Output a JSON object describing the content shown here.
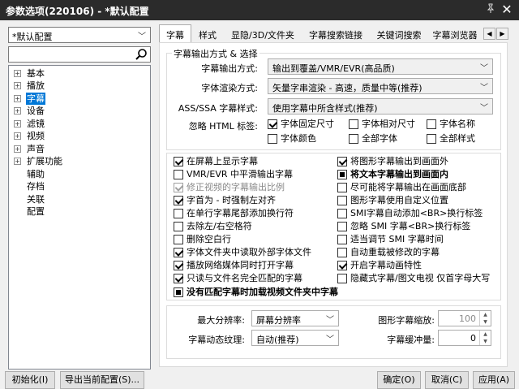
{
  "window": {
    "title": "参数选项(220106) - *默认配置",
    "pin_icon": "pin-icon",
    "close_icon": "close-icon"
  },
  "sidebar": {
    "profile": "*默认配置",
    "search_placeholder": "",
    "tree": [
      {
        "label": "基本",
        "expandable": true,
        "selected": false
      },
      {
        "label": "播放",
        "expandable": true,
        "selected": false
      },
      {
        "label": "字幕",
        "expandable": true,
        "selected": true
      },
      {
        "label": "设备",
        "expandable": true,
        "selected": false
      },
      {
        "label": "滤镜",
        "expandable": true,
        "selected": false
      },
      {
        "label": "视频",
        "expandable": true,
        "selected": false
      },
      {
        "label": "声音",
        "expandable": true,
        "selected": false
      },
      {
        "label": "扩展功能",
        "expandable": true,
        "selected": false
      },
      {
        "label": "辅助",
        "expandable": false,
        "selected": false
      },
      {
        "label": "存档",
        "expandable": false,
        "selected": false
      },
      {
        "label": "关联",
        "expandable": false,
        "selected": false
      },
      {
        "label": "配置",
        "expandable": false,
        "selected": false
      }
    ]
  },
  "tabs": [
    "字幕",
    "样式",
    "显隐/3D/文件夹",
    "字幕搜索链接",
    "关键词搜索",
    "字幕浏览器"
  ],
  "active_tab": 0,
  "output_group": {
    "title": "字幕输出方式 & 选择",
    "output_mode_label": "字幕输出方式:",
    "output_mode_value": "输出到覆盖/VMR/EVR(高品质)",
    "render_mode_label": "字体渲染方式:",
    "render_mode_value": "矢量字串渲染 - 高速，质量中等(推荐)",
    "ass_style_label": "ASS/SSA 字幕样式:",
    "ass_style_value": "使用字幕中所含样式(推荐)",
    "ignore_html_label": "忽略 HTML 标签:",
    "ignore_html": [
      {
        "label": "字体固定尺寸",
        "checked": true
      },
      {
        "label": "字体相对尺寸",
        "checked": false
      },
      {
        "label": "字体名称",
        "checked": false
      },
      {
        "label": "字体颜色",
        "checked": false
      },
      {
        "label": "全部字体",
        "checked": false
      },
      {
        "label": "全部样式",
        "checked": false
      }
    ]
  },
  "options_left": [
    {
      "label": "在屏幕上显示字幕",
      "state": "checked"
    },
    {
      "label": "VMR/EVR 中平滑输出字幕",
      "state": "unchecked"
    },
    {
      "label": "修正视频的字幕输出比例",
      "state": "disabled-checked"
    },
    {
      "label": "字首为 - 时强制左对齐",
      "state": "checked"
    },
    {
      "label": "在单行字幕尾部添加换行符",
      "state": "unchecked"
    },
    {
      "label": "去除左/右空格符",
      "state": "unchecked"
    },
    {
      "label": "删除空白行",
      "state": "unchecked"
    },
    {
      "label": "字体文件夹中读取外部字体文件",
      "state": "checked"
    },
    {
      "label": "播放网络媒体同时打开字幕",
      "state": "checked"
    },
    {
      "label": "只读与文件名完全匹配的字幕",
      "state": "checked"
    }
  ],
  "options_right": [
    {
      "label": "将图形字幕输出到画面外",
      "state": "checked",
      "bold": false
    },
    {
      "label": "将文本字幕输出到画面内",
      "state": "indeterminate",
      "bold": true
    },
    {
      "label": "尽可能将字幕输出在画面底部",
      "state": "unchecked",
      "bold": false
    },
    {
      "label": "图形字幕使用自定义位置",
      "state": "unchecked",
      "bold": false
    },
    {
      "label": "SMI字幕自动添加<BR>换行标签",
      "state": "unchecked",
      "bold": false
    },
    {
      "label": "忽略 SMI 字幕<BR>换行标签",
      "state": "unchecked",
      "bold": false
    },
    {
      "label": "适当调节 SMI 字幕时间",
      "state": "unchecked",
      "bold": false
    },
    {
      "label": "自动重载被修改的字幕",
      "state": "unchecked",
      "bold": false
    },
    {
      "label": "开启字幕动画特性",
      "state": "checked",
      "bold": false
    },
    {
      "label": "隐藏式字幕/图文电视 仅首字母大写",
      "state": "unchecked",
      "bold": false
    }
  ],
  "option_full": {
    "label": "没有匹配字幕时加载视频文件夹中字幕",
    "state": "indeterminate",
    "bold": true
  },
  "lower": {
    "max_res_label": "最大分辨率:",
    "max_res_value": "屏幕分辨率",
    "graphic_scale_label": "图形字幕缩放:",
    "graphic_scale_value": "100",
    "texture_label": "字幕动态纹理:",
    "texture_value": "自动(推荐)",
    "buffer_label": "字幕缓冲量:",
    "buffer_value": "0"
  },
  "footer": {
    "init_label": "初始化(I)",
    "export_label": "导出当前配置(S)...",
    "ok_label": "确定(O)",
    "cancel_label": "取消(C)",
    "apply_label": "应用(A)"
  }
}
